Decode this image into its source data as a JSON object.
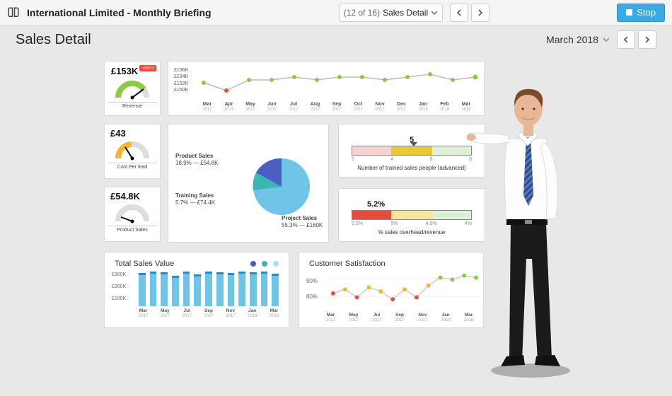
{
  "header": {
    "app_title": "International Limited - Monthly Briefing",
    "page_indicator": "(12 of 16)",
    "page_name": "Sales Detail",
    "stop_label": "Stop"
  },
  "subheader": {
    "title": "Sales Detail",
    "period": "March 2018"
  },
  "kpis": {
    "revenue": {
      "value": "£153K",
      "badge": "-£831",
      "label": "Revenue",
      "color": "#8acc41"
    },
    "cost_per_lead": {
      "value": "£43",
      "label": "Cost Per lead",
      "color": "#f2b72a"
    },
    "product_sales": {
      "value": "£54.8K",
      "label": "Product Sales",
      "color": "#333"
    }
  },
  "trained_sales": {
    "value": "5",
    "title": "Number of trained sales people (advanced)",
    "scale": [
      "2",
      "4",
      "6",
      "8"
    ]
  },
  "overhead": {
    "value": "5.2%",
    "title": "% sales overhead/revenue",
    "scale": [
      "5.5%",
      "5%",
      "4.5%",
      "4%"
    ]
  },
  "total_sales": {
    "title": "Total Sales Value"
  },
  "satisfaction": {
    "title": "Customer Satisfaction"
  },
  "pie_labels": {
    "product": "Product Sales",
    "product_v": "18.9% — £54.8K",
    "training": "Training Sales",
    "training_v": "5.7% — £74.4K",
    "project": "Project Sales",
    "project_v": "55.3% — £160K"
  },
  "chart_data": [
    {
      "id": "revenue_sparkline",
      "type": "line",
      "title": "Revenue (monthly)",
      "ylabel": "£K",
      "ylim": [
        150,
        156
      ],
      "yticks": [
        "£156K",
        "£154K",
        "£152K",
        "£150K"
      ],
      "categories": [
        "Mar 2017",
        "Apr 2017",
        "May 2017",
        "Jun 2017",
        "Jul 2017",
        "Aug 2017",
        "Sep 2017",
        "Oct 2017",
        "Nov 2017",
        "Dec 2017",
        "Jan 2018",
        "Feb 2018",
        "Mar 2018"
      ],
      "values": [
        152,
        150,
        153,
        153,
        154,
        153,
        154,
        154,
        153,
        154,
        155,
        153,
        154
      ]
    },
    {
      "id": "sales_breakdown_pie",
      "type": "pie",
      "title": "Sales breakdown",
      "series": [
        {
          "name": "Project Sales",
          "pct": 55.3,
          "amount_k_gbp": 160.0,
          "color": "#6fc5e8"
        },
        {
          "name": "Product Sales",
          "pct": 18.9,
          "amount_k_gbp": 54.8,
          "color": "#4a5fc1"
        },
        {
          "name": "Training Sales",
          "pct": 5.7,
          "amount_k_gbp": 74.4,
          "color": "#3bb6b0"
        }
      ]
    },
    {
      "id": "trained_bullet",
      "type": "bar",
      "title": "Number of trained sales people (advanced)",
      "value": 5,
      "range": [
        2,
        8
      ],
      "zones": [
        {
          "to": 4,
          "color": "#f7d1cd"
        },
        {
          "to": 6,
          "color": "#eac83a"
        },
        {
          "to": 8,
          "color": "#dff0d8"
        }
      ]
    },
    {
      "id": "overhead_bullet",
      "type": "bar",
      "title": "% sales overhead/revenue",
      "value": 5.2,
      "range": [
        5.5,
        4.0
      ],
      "zones": [
        {
          "to": 5.0,
          "color": "#e74c3c"
        },
        {
          "to": 4.5,
          "color": "#f7e5a0"
        },
        {
          "to": 4.0,
          "color": "#dff0d8"
        }
      ]
    },
    {
      "id": "total_sales_bars",
      "type": "bar",
      "title": "Total Sales Value",
      "ylabel": "£K",
      "ylim": [
        0,
        300
      ],
      "yticks": [
        "£300K",
        "£200K",
        "£100K"
      ],
      "categories": [
        "Mar 2017",
        "Apr 2017",
        "May 2017",
        "Jun 2017",
        "Jul 2017",
        "Aug 2017",
        "Sep 2017",
        "Oct 2017",
        "Nov 2017",
        "Dec 2017",
        "Jan 2018",
        "Feb 2018",
        "Mar 2018"
      ],
      "values": [
        275,
        285,
        280,
        250,
        285,
        265,
        285,
        280,
        275,
        290,
        280,
        290,
        270
      ]
    },
    {
      "id": "customer_satisfaction",
      "type": "line",
      "title": "Customer Satisfaction",
      "ylabel": "%",
      "ylim": [
        78,
        94
      ],
      "yticks": [
        "90%",
        "80%"
      ],
      "categories": [
        "Mar 2017",
        "Apr 2017",
        "May 2017",
        "Jun 2017",
        "Jul 2017",
        "Aug 2017",
        "Sep 2017",
        "Oct 2017",
        "Nov 2017",
        "Dec 2017",
        "Jan 2018",
        "Feb 2018",
        "Mar 2018"
      ],
      "values": [
        83,
        85,
        81,
        86,
        84,
        80,
        85,
        81,
        87,
        91,
        90,
        92,
        91
      ]
    }
  ]
}
